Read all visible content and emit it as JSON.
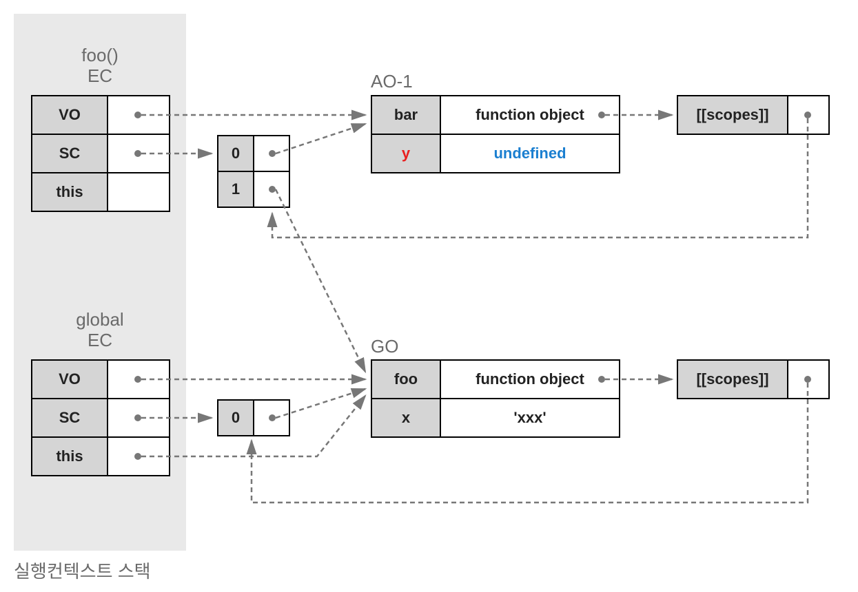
{
  "caption": "실행컨텍스트 스택",
  "foo_ec": {
    "title": "foo()\nEC",
    "rows": [
      "VO",
      "SC",
      "this"
    ]
  },
  "global_ec": {
    "title": "global\nEC",
    "rows": [
      "VO",
      "SC",
      "this"
    ]
  },
  "sc_foo": {
    "indices": [
      "0",
      "1"
    ]
  },
  "sc_global": {
    "indices": [
      "0"
    ]
  },
  "ao1": {
    "title": "AO-1",
    "rows": [
      {
        "key": "bar",
        "val": "function object",
        "key_class": "",
        "val_class": ""
      },
      {
        "key": "y",
        "val": "undefined",
        "key_class": "red",
        "val_class": "blue"
      }
    ]
  },
  "go": {
    "title": "GO",
    "rows": [
      {
        "key": "foo",
        "val": "function object"
      },
      {
        "key": "x",
        "val": "'xxx'"
      }
    ]
  },
  "scopes1": {
    "label": "[[scopes]]"
  },
  "scopes2": {
    "label": "[[scopes]]"
  }
}
